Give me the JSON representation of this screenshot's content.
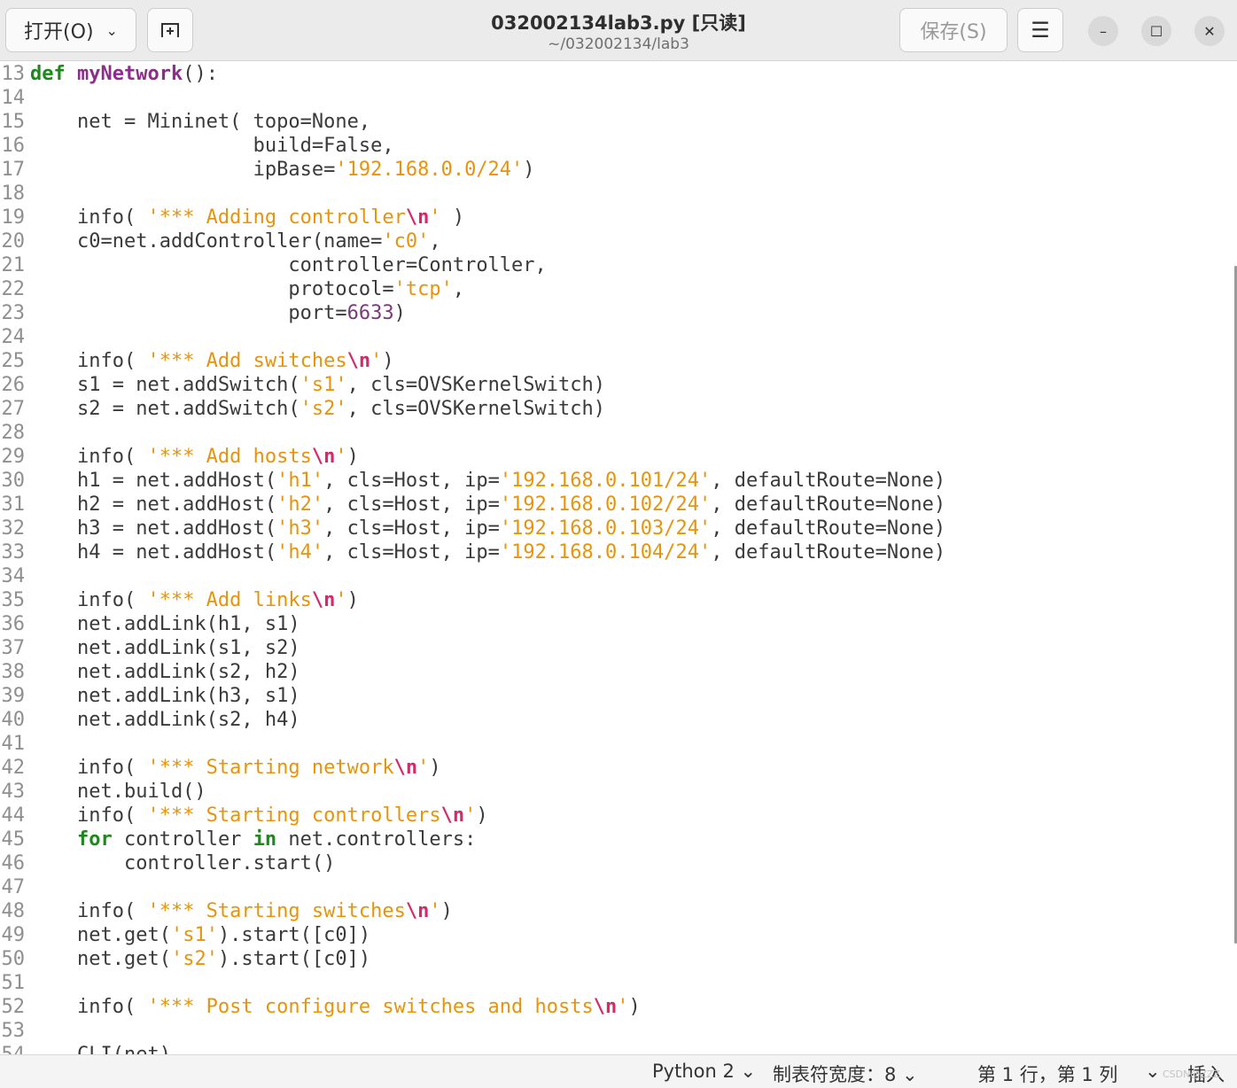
{
  "header": {
    "open_label": "打开(O)",
    "open_chevron": "⌄",
    "new_tab_icon": "new-tab-icon",
    "title": "032002134lab3.py [只读]",
    "path": "~/032002134/lab3",
    "save_label": "保存(S)",
    "menu_glyph": "☰",
    "minimize_glyph": "–",
    "maximize_glyph": "☐",
    "close_glyph": "✕"
  },
  "editor": {
    "lines": [
      {
        "n": "13",
        "t": [
          {
            "c": "kw",
            "v": "def"
          },
          {
            "c": "",
            "v": " "
          },
          {
            "c": "fn",
            "v": "myNetwork"
          },
          {
            "c": "",
            "v": "():"
          }
        ]
      },
      {
        "n": "14",
        "t": []
      },
      {
        "n": "15",
        "t": [
          {
            "c": "",
            "v": "    net = Mininet( topo=None,"
          }
        ]
      },
      {
        "n": "16",
        "t": [
          {
            "c": "",
            "v": "                   build=False,"
          }
        ]
      },
      {
        "n": "17",
        "t": [
          {
            "c": "",
            "v": "                   ipBase="
          },
          {
            "c": "st",
            "v": "'192.168.0.0/24'"
          },
          {
            "c": "",
            "v": ")"
          }
        ]
      },
      {
        "n": "18",
        "t": []
      },
      {
        "n": "19",
        "t": [
          {
            "c": "",
            "v": "    info( "
          },
          {
            "c": "st",
            "v": "'*** Adding controller"
          },
          {
            "c": "esc",
            "v": "\\n"
          },
          {
            "c": "st",
            "v": "'"
          },
          {
            "c": "",
            "v": " )"
          }
        ]
      },
      {
        "n": "20",
        "t": [
          {
            "c": "",
            "v": "    c0=net.addController(name="
          },
          {
            "c": "st",
            "v": "'c0'"
          },
          {
            "c": "",
            "v": ","
          }
        ]
      },
      {
        "n": "21",
        "t": [
          {
            "c": "",
            "v": "                      controller=Controller,"
          }
        ]
      },
      {
        "n": "22",
        "t": [
          {
            "c": "",
            "v": "                      protocol="
          },
          {
            "c": "st",
            "v": "'tcp'"
          },
          {
            "c": "",
            "v": ","
          }
        ]
      },
      {
        "n": "23",
        "t": [
          {
            "c": "",
            "v": "                      port="
          },
          {
            "c": "nm",
            "v": "6633"
          },
          {
            "c": "",
            "v": ")"
          }
        ]
      },
      {
        "n": "24",
        "t": []
      },
      {
        "n": "25",
        "t": [
          {
            "c": "",
            "v": "    info( "
          },
          {
            "c": "st",
            "v": "'*** Add switches"
          },
          {
            "c": "esc",
            "v": "\\n"
          },
          {
            "c": "st",
            "v": "'"
          },
          {
            "c": "",
            "v": ")"
          }
        ]
      },
      {
        "n": "26",
        "t": [
          {
            "c": "",
            "v": "    s1 = net.addSwitch("
          },
          {
            "c": "st",
            "v": "'s1'"
          },
          {
            "c": "",
            "v": ", cls=OVSKernelSwitch)"
          }
        ]
      },
      {
        "n": "27",
        "t": [
          {
            "c": "",
            "v": "    s2 = net.addSwitch("
          },
          {
            "c": "st",
            "v": "'s2'"
          },
          {
            "c": "",
            "v": ", cls=OVSKernelSwitch)"
          }
        ]
      },
      {
        "n": "28",
        "t": []
      },
      {
        "n": "29",
        "t": [
          {
            "c": "",
            "v": "    info( "
          },
          {
            "c": "st",
            "v": "'*** Add hosts"
          },
          {
            "c": "esc",
            "v": "\\n"
          },
          {
            "c": "st",
            "v": "'"
          },
          {
            "c": "",
            "v": ")"
          }
        ]
      },
      {
        "n": "30",
        "t": [
          {
            "c": "",
            "v": "    h1 = net.addHost("
          },
          {
            "c": "st",
            "v": "'h1'"
          },
          {
            "c": "",
            "v": ", cls=Host, ip="
          },
          {
            "c": "st",
            "v": "'192.168.0.101/24'"
          },
          {
            "c": "",
            "v": ", defaultRoute=None)"
          }
        ]
      },
      {
        "n": "31",
        "t": [
          {
            "c": "",
            "v": "    h2 = net.addHost("
          },
          {
            "c": "st",
            "v": "'h2'"
          },
          {
            "c": "",
            "v": ", cls=Host, ip="
          },
          {
            "c": "st",
            "v": "'192.168.0.102/24'"
          },
          {
            "c": "",
            "v": ", defaultRoute=None)"
          }
        ]
      },
      {
        "n": "32",
        "t": [
          {
            "c": "",
            "v": "    h3 = net.addHost("
          },
          {
            "c": "st",
            "v": "'h3'"
          },
          {
            "c": "",
            "v": ", cls=Host, ip="
          },
          {
            "c": "st",
            "v": "'192.168.0.103/24'"
          },
          {
            "c": "",
            "v": ", defaultRoute=None)"
          }
        ]
      },
      {
        "n": "33",
        "t": [
          {
            "c": "",
            "v": "    h4 = net.addHost("
          },
          {
            "c": "st",
            "v": "'h4'"
          },
          {
            "c": "",
            "v": ", cls=Host, ip="
          },
          {
            "c": "st",
            "v": "'192.168.0.104/24'"
          },
          {
            "c": "",
            "v": ", defaultRoute=None)"
          }
        ]
      },
      {
        "n": "34",
        "t": []
      },
      {
        "n": "35",
        "t": [
          {
            "c": "",
            "v": "    info( "
          },
          {
            "c": "st",
            "v": "'*** Add links"
          },
          {
            "c": "esc",
            "v": "\\n"
          },
          {
            "c": "st",
            "v": "'"
          },
          {
            "c": "",
            "v": ")"
          }
        ]
      },
      {
        "n": "36",
        "t": [
          {
            "c": "",
            "v": "    net.addLink(h1, s1)"
          }
        ]
      },
      {
        "n": "37",
        "t": [
          {
            "c": "",
            "v": "    net.addLink(s1, s2)"
          }
        ]
      },
      {
        "n": "38",
        "t": [
          {
            "c": "",
            "v": "    net.addLink(s2, h2)"
          }
        ]
      },
      {
        "n": "39",
        "t": [
          {
            "c": "",
            "v": "    net.addLink(h3, s1)"
          }
        ]
      },
      {
        "n": "40",
        "t": [
          {
            "c": "",
            "v": "    net.addLink(s2, h4)"
          }
        ]
      },
      {
        "n": "41",
        "t": []
      },
      {
        "n": "42",
        "t": [
          {
            "c": "",
            "v": "    info( "
          },
          {
            "c": "st",
            "v": "'*** Starting network"
          },
          {
            "c": "esc",
            "v": "\\n"
          },
          {
            "c": "st",
            "v": "'"
          },
          {
            "c": "",
            "v": ")"
          }
        ]
      },
      {
        "n": "43",
        "t": [
          {
            "c": "",
            "v": "    net.build()"
          }
        ]
      },
      {
        "n": "44",
        "t": [
          {
            "c": "",
            "v": "    info( "
          },
          {
            "c": "st",
            "v": "'*** Starting controllers"
          },
          {
            "c": "esc",
            "v": "\\n"
          },
          {
            "c": "st",
            "v": "'"
          },
          {
            "c": "",
            "v": ")"
          }
        ]
      },
      {
        "n": "45",
        "t": [
          {
            "c": "",
            "v": "    "
          },
          {
            "c": "kw",
            "v": "for"
          },
          {
            "c": "",
            "v": " controller "
          },
          {
            "c": "kw",
            "v": "in"
          },
          {
            "c": "",
            "v": " net.controllers:"
          }
        ]
      },
      {
        "n": "46",
        "t": [
          {
            "c": "",
            "v": "        controller.start()"
          }
        ]
      },
      {
        "n": "47",
        "t": []
      },
      {
        "n": "48",
        "t": [
          {
            "c": "",
            "v": "    info( "
          },
          {
            "c": "st",
            "v": "'*** Starting switches"
          },
          {
            "c": "esc",
            "v": "\\n"
          },
          {
            "c": "st",
            "v": "'"
          },
          {
            "c": "",
            "v": ")"
          }
        ]
      },
      {
        "n": "49",
        "t": [
          {
            "c": "",
            "v": "    net.get("
          },
          {
            "c": "st",
            "v": "'s1'"
          },
          {
            "c": "",
            "v": ").start([c0])"
          }
        ]
      },
      {
        "n": "50",
        "t": [
          {
            "c": "",
            "v": "    net.get("
          },
          {
            "c": "st",
            "v": "'s2'"
          },
          {
            "c": "",
            "v": ").start([c0])"
          }
        ]
      },
      {
        "n": "51",
        "t": []
      },
      {
        "n": "52",
        "t": [
          {
            "c": "",
            "v": "    info( "
          },
          {
            "c": "st",
            "v": "'*** Post configure switches and hosts"
          },
          {
            "c": "esc",
            "v": "\\n"
          },
          {
            "c": "st",
            "v": "'"
          },
          {
            "c": "",
            "v": ")"
          }
        ]
      },
      {
        "n": "53",
        "t": []
      },
      {
        "n": "54",
        "t": [
          {
            "c": "",
            "v": "    CLI(net)"
          }
        ]
      }
    ]
  },
  "status": {
    "language": "Python 2 ⌄",
    "tab_width": "制表符宽度：8 ⌄",
    "cursor": "第 1 行，第 1 列",
    "mode_chevron": "⌄",
    "mode": "插入"
  },
  "watermark": "CSDN@ZZZ"
}
